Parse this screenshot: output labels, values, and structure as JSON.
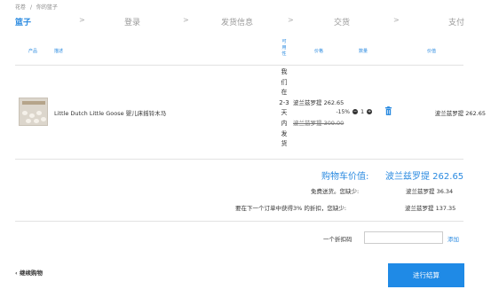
{
  "breadcrumb": {
    "home": "花卷",
    "separator": "/",
    "current": "你的篮子"
  },
  "steps": [
    {
      "label": "篮子",
      "active": true
    },
    {
      "label": "登录",
      "active": false
    },
    {
      "label": "发货信息",
      "active": false
    },
    {
      "label": "交货",
      "active": false
    },
    {
      "label": "支付",
      "active": false
    }
  ],
  "step_arrow": ">",
  "table": {
    "headers": {
      "product": "产品",
      "description": "描述",
      "availability": "可用性",
      "price": "价格",
      "quantity": "数量",
      "total": "价值"
    }
  },
  "item": {
    "name": "Little Dutch Little Goose 婴儿床摇铃木马",
    "availability": "我们在2-3天内发货",
    "price": "波兰兹罗提 262.65",
    "discount": "-15%",
    "old_price": "波兰兹罗提 309.00",
    "quantity": "1",
    "line_total": "波兰兹罗提 262.65"
  },
  "summary": {
    "cart_value_label": "购物车价值:",
    "cart_value": "波兰兹罗提 262.65",
    "free_shipping_label": "免费送货。您缺少:",
    "free_shipping_value": "波兰兹罗提 36.34",
    "next_order_label": "要在下一个订单中获得3% 的折扣，您缺少:",
    "next_order_value": "波兰兹罗提 137.35"
  },
  "discount_code": {
    "label": "一个折扣码",
    "placeholder": "",
    "add_label": "添加"
  },
  "footer": {
    "back_label": "继续购物",
    "checkout_label": "进行结算"
  },
  "colors": {
    "accent": "#2a8ae0",
    "button": "#1f8ae6"
  }
}
